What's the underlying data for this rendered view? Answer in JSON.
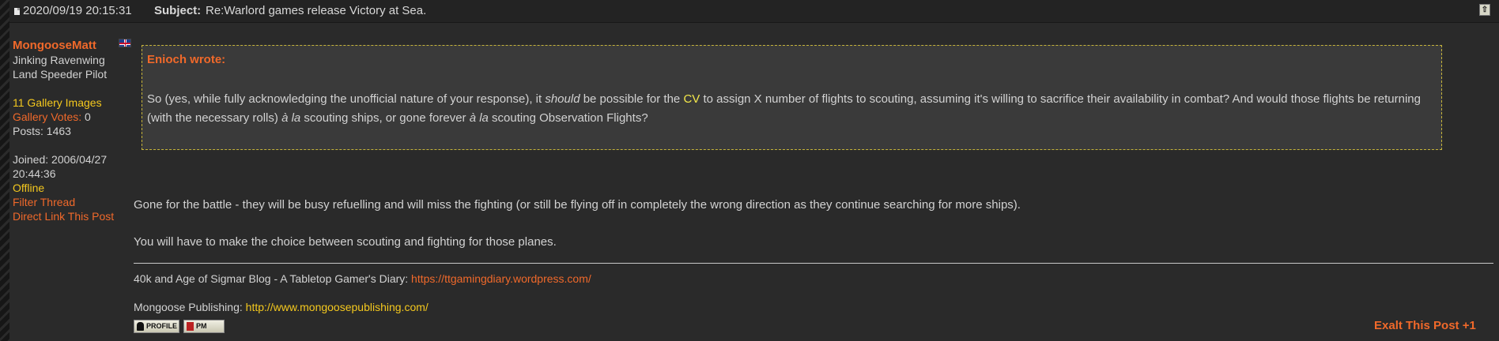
{
  "header": {
    "date": "2020/09/19 20:15:31",
    "subject_label": "Subject:",
    "subject": "Re:Warlord games release Victory at Sea.",
    "top_icon": "arrow-up-icon"
  },
  "sidebar": {
    "username": "MongooseMatt",
    "flag_icon": "uk-flag-icon",
    "rank1": "Jinking Ravenwing",
    "rank2": "Land Speeder Pilot",
    "gallery_images": "11 Gallery Images",
    "gallery_votes_label": "Gallery Votes:",
    "gallery_votes_value": " 0",
    "posts": "Posts: 1463",
    "joined1": "Joined: 2006/04/27",
    "joined2": "20:44:36",
    "status": "Offline",
    "filter_thread": "Filter Thread",
    "direct_link": "Direct Link This Post"
  },
  "quote": {
    "author": "Enioch wrote:",
    "part1": "So (yes, while fully acknowledging the unofficial nature of your response), it ",
    "should": "should",
    "part2": " be possible for the ",
    "cv": "CV",
    "part3": " to assign X number of flights to scouting, assuming it's willing to sacrifice their availability in combat? And would those flights be returning (with the necessary rolls) ",
    "ala1": "à la",
    "part4": " scouting ships, or gone forever ",
    "ala2": "à la",
    "part5": " scouting Observation Flights?"
  },
  "body": {
    "line1": "Gone for the battle - they will be busy refuelling and will miss the fighting (or still be flying off in completely the wrong direction as they continue searching for more ships).",
    "line2": "You will have to make the choice between scouting and fighting for those planes."
  },
  "signature": {
    "blog_text": "40k and Age of Sigmar Blog - A Tabletop Gamer's Diary: ",
    "blog_url": "https://ttgamingdiary.wordpress.com/",
    "pub_text": "Mongoose Publishing: ",
    "pub_url": "http://www.mongoosepublishing.com/"
  },
  "actions": {
    "profile": "PROFILE",
    "pm": "PM",
    "exalt": "Exalt This Post +1"
  },
  "colors": {
    "accent_orange": "#f0692a",
    "accent_yellow": "#f4c81e",
    "background": "#2a2a2a"
  }
}
